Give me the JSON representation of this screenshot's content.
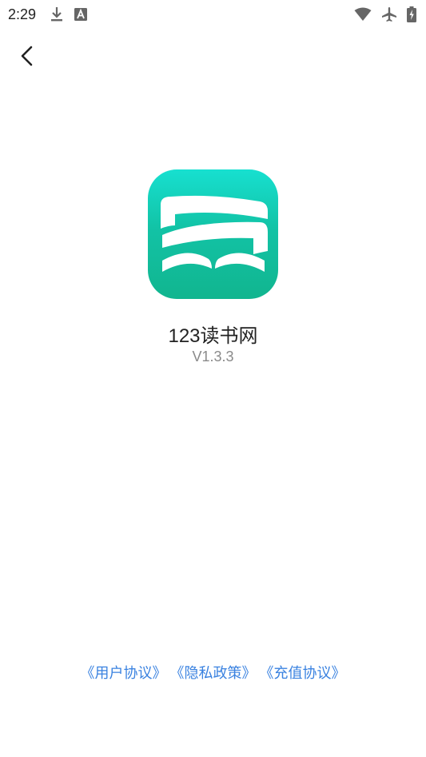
{
  "status_bar": {
    "time": "2:29",
    "icons_left": [
      "download-icon",
      "font-a-icon"
    ],
    "icons_right": [
      "wifi-icon",
      "airplane-mode-icon",
      "battery-charging-icon"
    ]
  },
  "nav": {
    "back_icon": "chevron-left-icon"
  },
  "app": {
    "name": "123读书网",
    "version": "V1.3.3",
    "logo_icon": "open-book-logo-icon",
    "logo_color_top": "#17e0d0",
    "logo_color_bottom": "#11b58f"
  },
  "footer": {
    "links": [
      {
        "label": "《用户协议》"
      },
      {
        "label": "《隐私政策》"
      },
      {
        "label": "《充值协议》"
      }
    ],
    "link_color": "#3a82e0"
  }
}
